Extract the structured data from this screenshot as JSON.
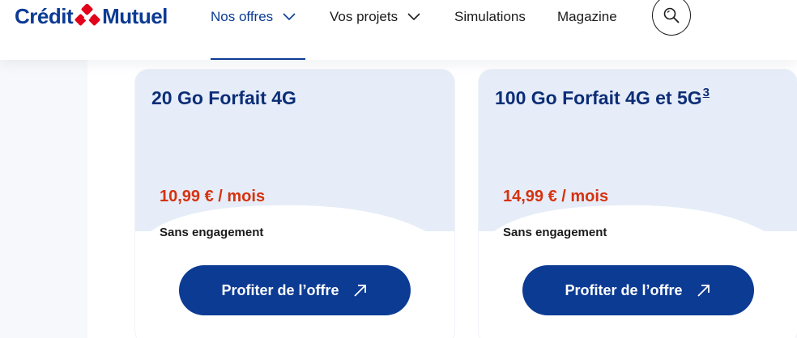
{
  "header": {
    "logo_left": "Crédit",
    "logo_right": "Mutuel",
    "nav": [
      {
        "label": "Nos offres",
        "has_dropdown": true,
        "active": true
      },
      {
        "label": "Vos projets",
        "has_dropdown": true,
        "active": false
      },
      {
        "label": "Simulations",
        "has_dropdown": false,
        "active": false
      },
      {
        "label": "Magazine",
        "has_dropdown": false,
        "active": false
      }
    ],
    "search_icon": "search-icon"
  },
  "offers": [
    {
      "title": "20 Go Forfait 4G",
      "footnote": "",
      "price": "10,99 € / mois",
      "engagement": "Sans engagement",
      "cta_label": "Profiter de l’offre",
      "cta_icon": "arrow-up-right-icon"
    },
    {
      "title": "100 Go Forfait 4G et 5G",
      "footnote": "3",
      "price": "14,99 € / mois",
      "engagement": "Sans engagement",
      "cta_label": "Profiter de l’offre",
      "cta_icon": "arrow-up-right-icon"
    }
  ],
  "colors": {
    "brand_blue": "#0c3b94",
    "title_blue": "#0c2d77",
    "price_red": "#d6320f",
    "card_top": "#e6edf8",
    "logo_red": "#e2001a"
  }
}
